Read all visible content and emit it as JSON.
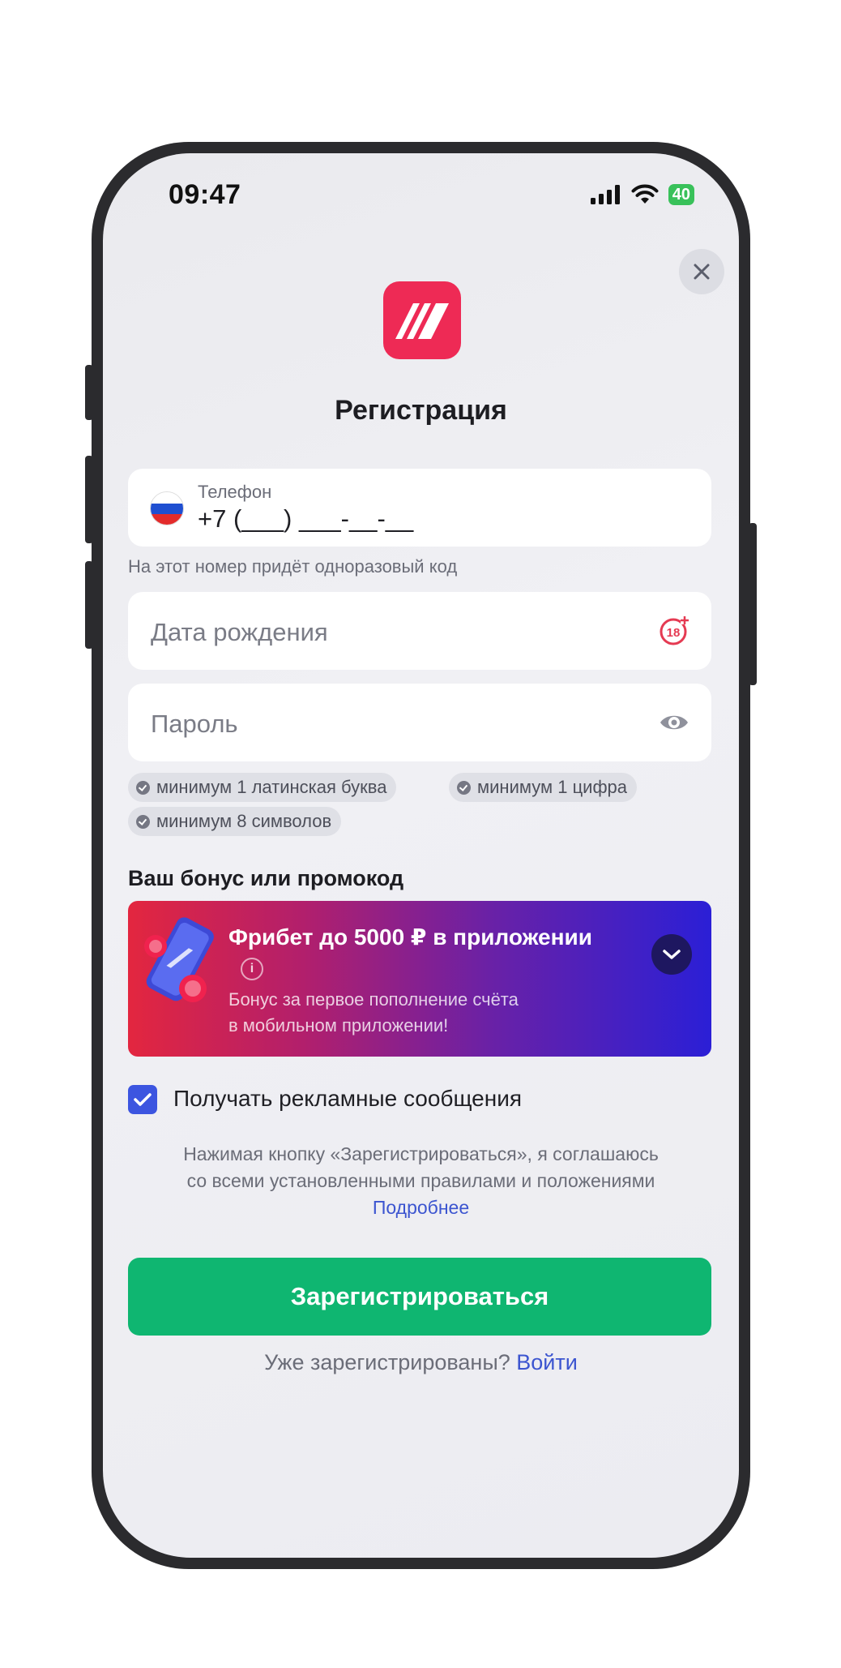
{
  "status_bar": {
    "time": "09:47",
    "battery": "40"
  },
  "logo": {
    "brand_color": "#ee2a55",
    "icon": "brand-logo-icon"
  },
  "title": "Регистрация",
  "phone_field": {
    "label": "Телефон",
    "value": "+7 (___) ___-__-__",
    "hint": "На этот номер придёт одноразовый код",
    "flag_icon": "russia-flag-icon"
  },
  "birth_field": {
    "placeholder": "Дата рождения",
    "icon": "age-18-plus-icon"
  },
  "password_field": {
    "placeholder": "Пароль",
    "icon": "eye-icon"
  },
  "password_rules": [
    "минимум 1 латинская буква",
    "минимум 1 цифра",
    "минимум 8 символов"
  ],
  "bonus": {
    "heading": "Ваш бонус или промокод",
    "title": "Фрибет до 5000 ₽ в приложении",
    "description_line1": "Бонус за первое пополнение счёта",
    "description_line2": "в мобильном приложении!",
    "info_icon": "info-icon",
    "toggle_icon": "chevron-down-icon"
  },
  "marketing": {
    "label": "Получать рекламные сообщения",
    "checked": true
  },
  "terms": {
    "line1": "Нажимая кнопку «Зарегистрироваться», я соглашаюсь",
    "line2": "со всеми установленными правилами и положениями",
    "link": "Подробнее"
  },
  "register_button": "Зарегистрироваться",
  "login": {
    "text": "Уже зарегистрированы?",
    "link": "Войти"
  },
  "colors": {
    "accent_green": "#0fb671",
    "link_blue": "#3c55d0",
    "checkbox_blue": "#3c55e0"
  }
}
